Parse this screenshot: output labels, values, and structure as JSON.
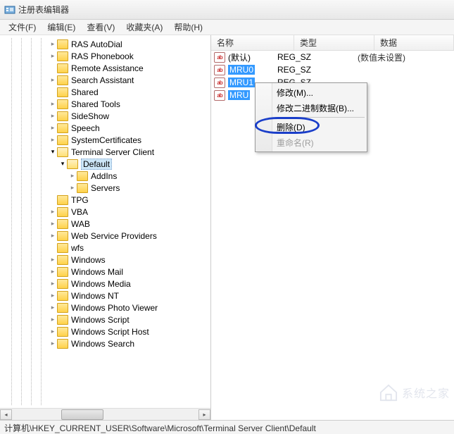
{
  "window": {
    "title": "注册表编辑器"
  },
  "menu": {
    "file": "文件(F)",
    "edit": "编辑(E)",
    "view": "查看(V)",
    "fav": "收藏夹(A)",
    "help": "帮助(H)"
  },
  "tree": [
    {
      "indent": 5,
      "tw": "closed",
      "label": "RAS AutoDial"
    },
    {
      "indent": 5,
      "tw": "closed",
      "label": "RAS Phonebook"
    },
    {
      "indent": 5,
      "tw": "none",
      "label": "Remote Assistance"
    },
    {
      "indent": 5,
      "tw": "closed",
      "label": "Search Assistant"
    },
    {
      "indent": 5,
      "tw": "none",
      "label": "Shared"
    },
    {
      "indent": 5,
      "tw": "closed",
      "label": "Shared Tools"
    },
    {
      "indent": 5,
      "tw": "closed",
      "label": "SideShow"
    },
    {
      "indent": 5,
      "tw": "closed",
      "label": "Speech"
    },
    {
      "indent": 5,
      "tw": "closed",
      "label": "SystemCertificates"
    },
    {
      "indent": 5,
      "tw": "open",
      "label": "Terminal Server Client",
      "open": true
    },
    {
      "indent": 6,
      "tw": "open",
      "label": "Default",
      "open": true,
      "selected": true
    },
    {
      "indent": 7,
      "tw": "closed",
      "label": "AddIns"
    },
    {
      "indent": 7,
      "tw": "closed",
      "label": "Servers"
    },
    {
      "indent": 5,
      "tw": "none",
      "label": "TPG"
    },
    {
      "indent": 5,
      "tw": "closed",
      "label": "VBA"
    },
    {
      "indent": 5,
      "tw": "closed",
      "label": "WAB"
    },
    {
      "indent": 5,
      "tw": "closed",
      "label": "Web Service Providers"
    },
    {
      "indent": 5,
      "tw": "none",
      "label": "wfs"
    },
    {
      "indent": 5,
      "tw": "closed",
      "label": "Windows"
    },
    {
      "indent": 5,
      "tw": "closed",
      "label": "Windows Mail"
    },
    {
      "indent": 5,
      "tw": "closed",
      "label": "Windows Media"
    },
    {
      "indent": 5,
      "tw": "closed",
      "label": "Windows NT"
    },
    {
      "indent": 5,
      "tw": "closed",
      "label": "Windows Photo Viewer"
    },
    {
      "indent": 5,
      "tw": "closed",
      "label": "Windows Script"
    },
    {
      "indent": 5,
      "tw": "closed",
      "label": "Windows Script Host"
    },
    {
      "indent": 5,
      "tw": "closed",
      "label": "Windows Search"
    }
  ],
  "list": {
    "headers": {
      "name": "名称",
      "type": "类型",
      "data": "数据"
    },
    "rows": [
      {
        "name": "(默认)",
        "type": "REG_SZ",
        "data": "(数值未设置)",
        "selected": false
      },
      {
        "name": "MRU0",
        "type": "REG_SZ",
        "data": "",
        "selected": true
      },
      {
        "name": "MRU1",
        "type": "REG_SZ",
        "data": "",
        "selected": true
      },
      {
        "name": "MRU",
        "type": "",
        "data": "",
        "selected": true,
        "truncated": true
      }
    ]
  },
  "contextmenu": {
    "modify": "修改(M)...",
    "modifybin": "修改二进制数据(B)...",
    "delete": "删除(D)",
    "rename": "重命名(R)"
  },
  "status": "计算机\\HKEY_CURRENT_USER\\Software\\Microsoft\\Terminal Server Client\\Default",
  "watermark": "系统之家"
}
